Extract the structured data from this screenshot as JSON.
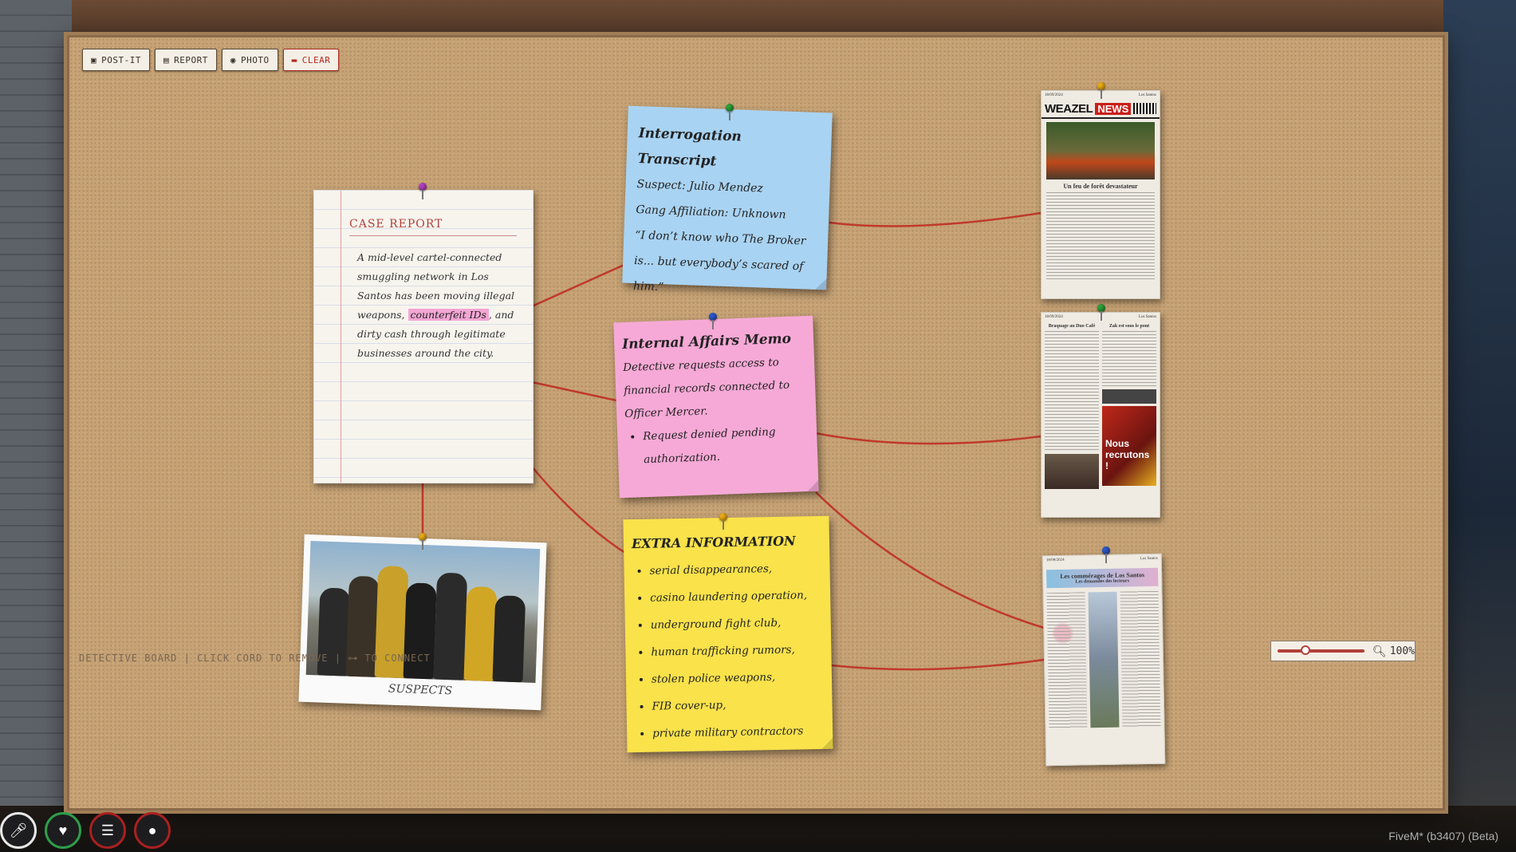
{
  "toolbar": {
    "postit": "POST-IT",
    "report": "REPORT",
    "photo": "PHOTO",
    "clear": "CLEAR"
  },
  "case_report": {
    "title": "CASE REPORT",
    "text_before": "A mid-level cartel-connected smuggling network in Los Santos has been moving illegal weapons, ",
    "highlight": "counterfeit IDs",
    "text_after": ", and dirty cash through legitimate businesses around the city."
  },
  "notes": {
    "interrogation": {
      "title": "Interrogation Transcript",
      "suspect": "Suspect: Julio Mendez",
      "gang": "Gang Affiliation: Unknown",
      "quote": "“I don’t know who The Broker is... but everybody’s scared of him.”"
    },
    "internal_affairs": {
      "title": "Internal Affairs Memo",
      "body": "Detective requests access to financial records connected to Officer Mercer.",
      "bullet": "Request denied pending authorization."
    },
    "extra": {
      "title": "EXTRA INFORMATION",
      "items": [
        "serial disappearances,",
        "casino laundering operation,",
        "underground fight club,",
        "human trafficking rumors,",
        "stolen police weapons,",
        "FIB cover-up,",
        "private military contractors"
      ]
    }
  },
  "photo": {
    "caption": "SUSPECTS"
  },
  "newspapers": [
    {
      "date": "18/09/2024",
      "brand": "Los Santos",
      "name": "WEAZEL",
      "tag": "NEWS",
      "headline": "Un feu de forêt devastateur"
    },
    {
      "date": "18/09/2024",
      "brand": "Los Santos",
      "headline_left": "Braquage au Duo Café",
      "headline_right": "Zak est sous le pont",
      "ad": "Nous recrutons !"
    },
    {
      "date": "18/09/2024",
      "brand": "Los Santos",
      "headline": "Les commérages de Los Santos",
      "sub": "Les demandes des lecteurs"
    }
  ],
  "footer": "DETECTIVE BOARD | CLICK CORD TO REMOVE | ⊶ TO CONNECT",
  "zoom": {
    "value": "100%",
    "level": 0.25
  },
  "hud": {
    "mic": "microphone-icon",
    "health": "heart-icon",
    "food": "burger-icon",
    "water": "drop-icon"
  },
  "status": "FiveM* (b3407) (Beta)",
  "colors": {
    "cord": "#c0392b",
    "board": "#c6a275",
    "accent": "#b2403a"
  }
}
